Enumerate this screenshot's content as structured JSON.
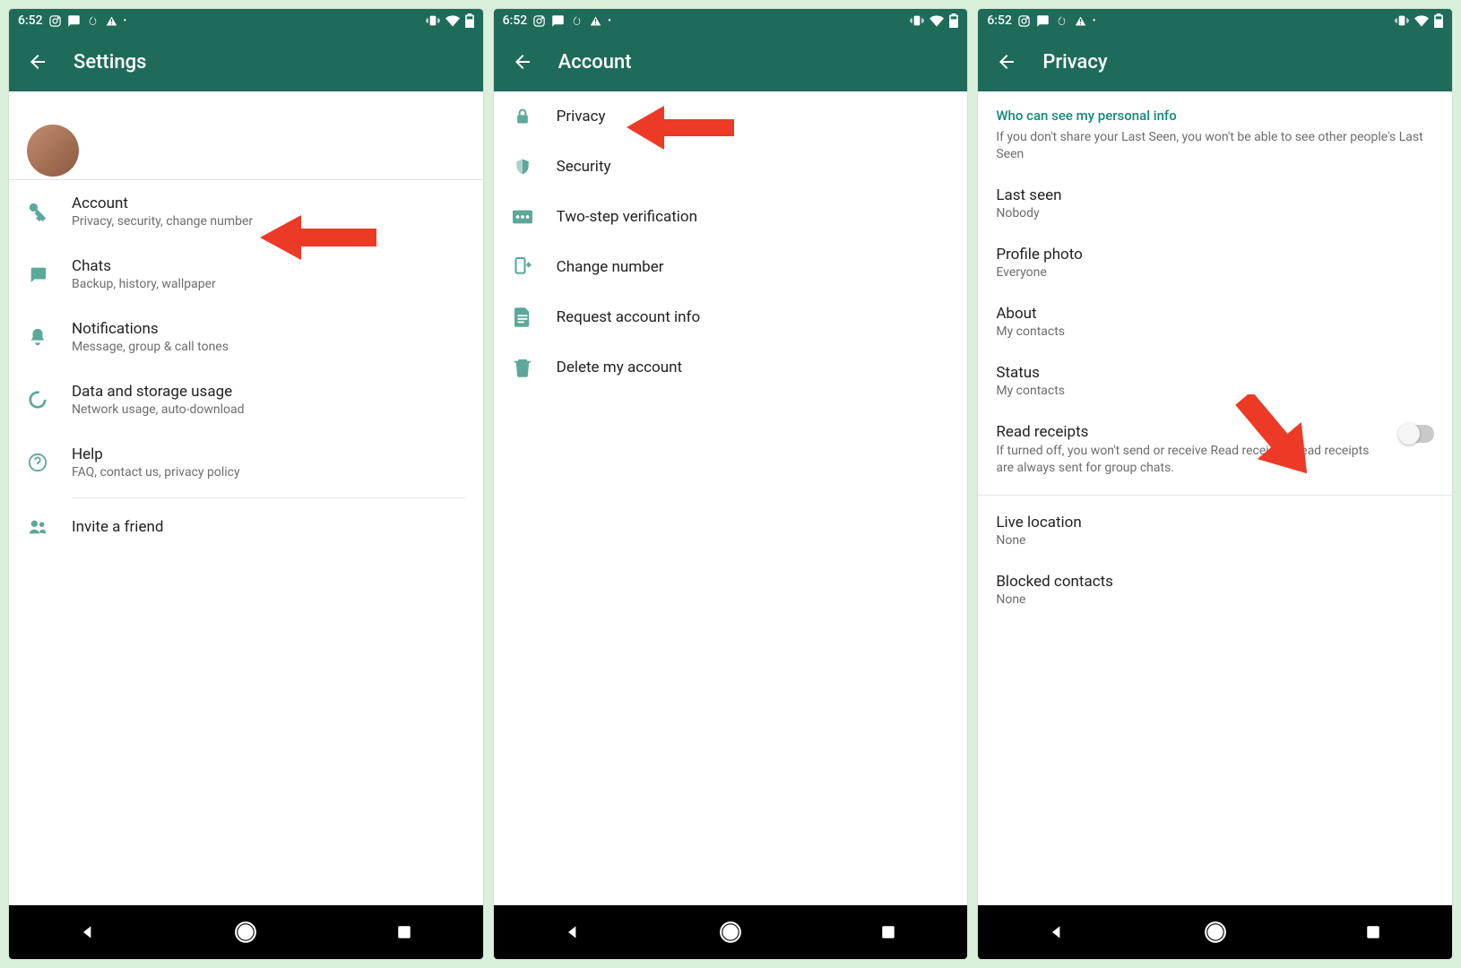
{
  "statusbar": {
    "time": "6:52"
  },
  "screen1": {
    "title": "Settings",
    "items": [
      {
        "icon": "key",
        "title": "Account",
        "sub": "Privacy, security, change number"
      },
      {
        "icon": "chat",
        "title": "Chats",
        "sub": "Backup, history, wallpaper"
      },
      {
        "icon": "bell",
        "title": "Notifications",
        "sub": "Message, group & call tones"
      },
      {
        "icon": "data",
        "title": "Data and storage usage",
        "sub": "Network usage, auto-download"
      },
      {
        "icon": "help",
        "title": "Help",
        "sub": "FAQ, contact us, privacy policy"
      }
    ],
    "invite": {
      "title": "Invite a friend"
    }
  },
  "screen2": {
    "title": "Account",
    "items": [
      {
        "icon": "lock",
        "title": "Privacy"
      },
      {
        "icon": "shield",
        "title": "Security"
      },
      {
        "icon": "dots",
        "title": "Two-step verification"
      },
      {
        "icon": "swap",
        "title": "Change number"
      },
      {
        "icon": "doc",
        "title": "Request account info"
      },
      {
        "icon": "trash",
        "title": "Delete my account"
      }
    ]
  },
  "screen3": {
    "title": "Privacy",
    "section_header": "Who can see my personal info",
    "section_sub": "If you don't share your Last Seen, you won't be able to see other people's Last Seen",
    "prefs": [
      {
        "title": "Last seen",
        "value": "Nobody"
      },
      {
        "title": "Profile photo",
        "value": "Everyone"
      },
      {
        "title": "About",
        "value": "My contacts"
      },
      {
        "title": "Status",
        "value": "My contacts"
      }
    ],
    "read_receipts": {
      "title": "Read receipts",
      "desc": "If turned off, you won't send or receive Read receipts. Read receipts are always sent for group chats."
    },
    "live_location": {
      "title": "Live location",
      "value": "None"
    },
    "blocked": {
      "title": "Blocked contacts",
      "value": "None"
    }
  }
}
